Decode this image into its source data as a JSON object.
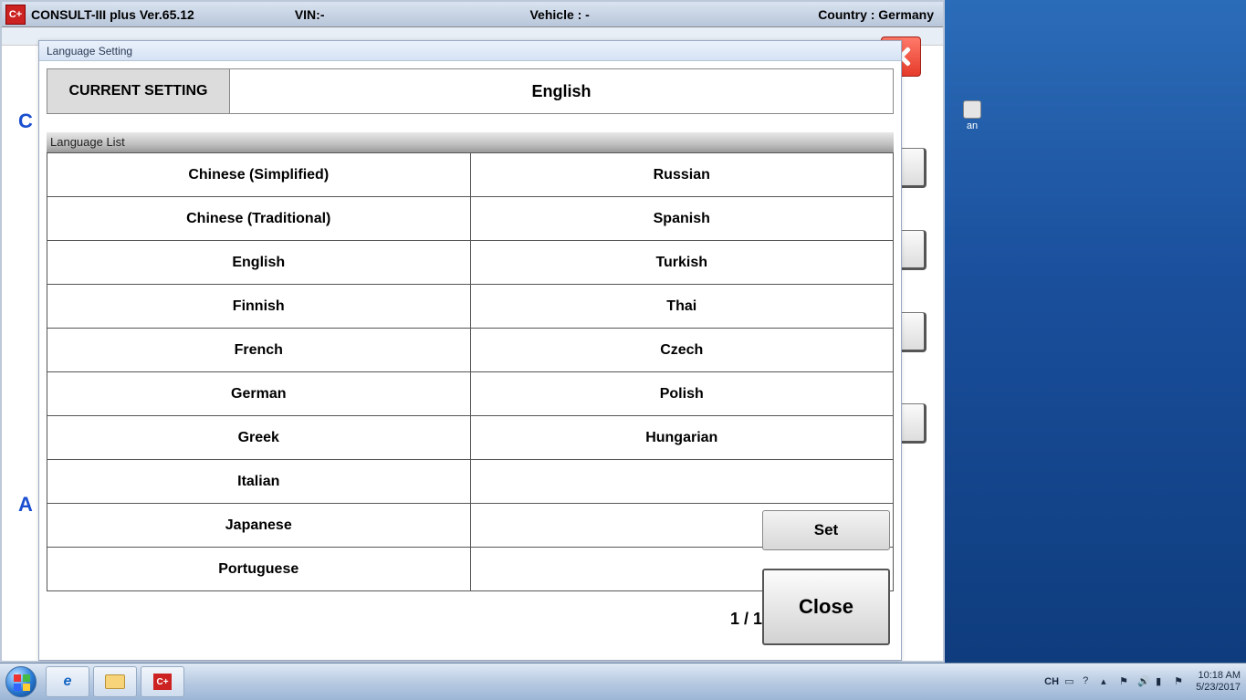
{
  "app": {
    "icon_text": "C+",
    "title": "CONSULT-III plus",
    "version": "Ver.65.12",
    "vin_label": "VIN:-",
    "vehicle_label": "Vehicle : -",
    "country_label": "Country : Germany"
  },
  "bg": {
    "letter_c": "C",
    "letter_a": "A"
  },
  "desktop": {
    "icon_label": "an"
  },
  "modal": {
    "title": "Language Setting",
    "current_label": "CURRENT SETTING",
    "current_value": "English",
    "list_header": "Language List",
    "languages_col1": [
      "Chinese (Simplified)",
      "Chinese (Traditional)",
      "English",
      "Finnish",
      "French",
      "German",
      "Greek",
      "Italian",
      "Japanese",
      "Portuguese"
    ],
    "languages_col2": [
      "Russian",
      "Spanish",
      "Turkish",
      "Thai",
      "Czech",
      "Polish",
      "Hungarian",
      "",
      "",
      ""
    ],
    "page_indicator": "1 / 1",
    "set_label": "Set",
    "close_label": "Close"
  },
  "taskbar": {
    "app_icon_text": "C+",
    "lang_indicator": "CH",
    "time": "10:18 AM",
    "date": "5/23/2017"
  }
}
